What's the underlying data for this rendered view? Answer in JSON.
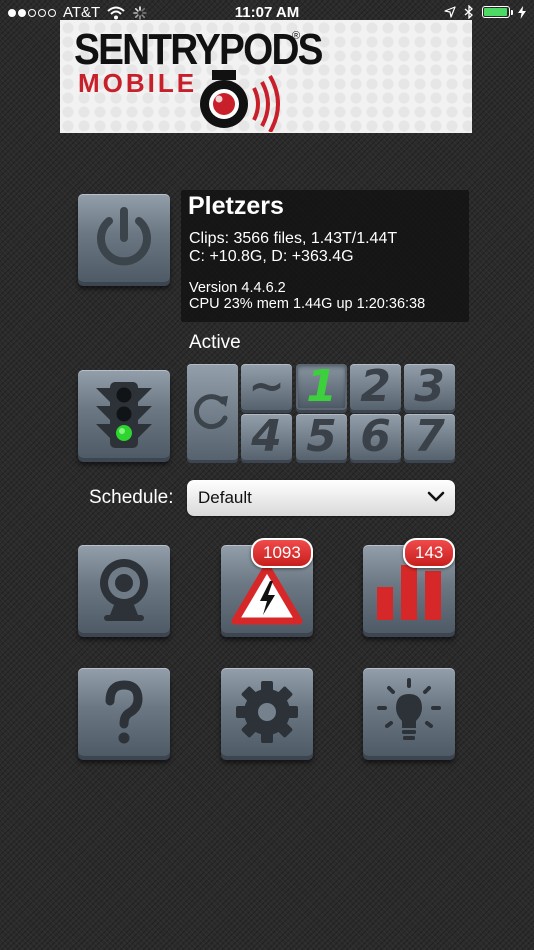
{
  "status_bar": {
    "carrier": "AT&T",
    "time": "11:07 AM",
    "battery_level": 0.95,
    "signal_bars_filled": 2,
    "signal_bars_total": 5
  },
  "banner": {
    "logo_line1": "SENTRYPODS",
    "logo_registered": "®",
    "logo_line2": "MOBILE"
  },
  "server": {
    "name": "Pletzers",
    "clips": "Clips: 3566 files, 1.43T/1.44T",
    "drives": "C: +10.8G, D: +363.4G",
    "version": "Version 4.4.6.2",
    "stats": "CPU 23% mem 1.44G up 1:20:36:38"
  },
  "profile": {
    "state_label": "Active",
    "buttons": [
      "~",
      "1",
      "2",
      "3",
      "4",
      "5",
      "6",
      "7"
    ],
    "selected": "1"
  },
  "schedule": {
    "label": "Schedule:",
    "value": "Default"
  },
  "badges": {
    "alerts": "1093",
    "stats": "143"
  },
  "colors": {
    "active_profile": "#3cd03c",
    "badge_red": "#d62828",
    "traffic_green": "#2ed52e",
    "tile_gray": "#6b7884"
  },
  "icons": {
    "power": "power-icon",
    "traffic_light": "traffic-light-icon",
    "refresh": "refresh-icon",
    "camera": "webcam-icon",
    "alerts": "high-voltage-warning-icon",
    "statistics": "bar-chart-icon",
    "help": "question-mark-icon",
    "settings": "gear-icon",
    "tips": "lightbulb-icon"
  }
}
